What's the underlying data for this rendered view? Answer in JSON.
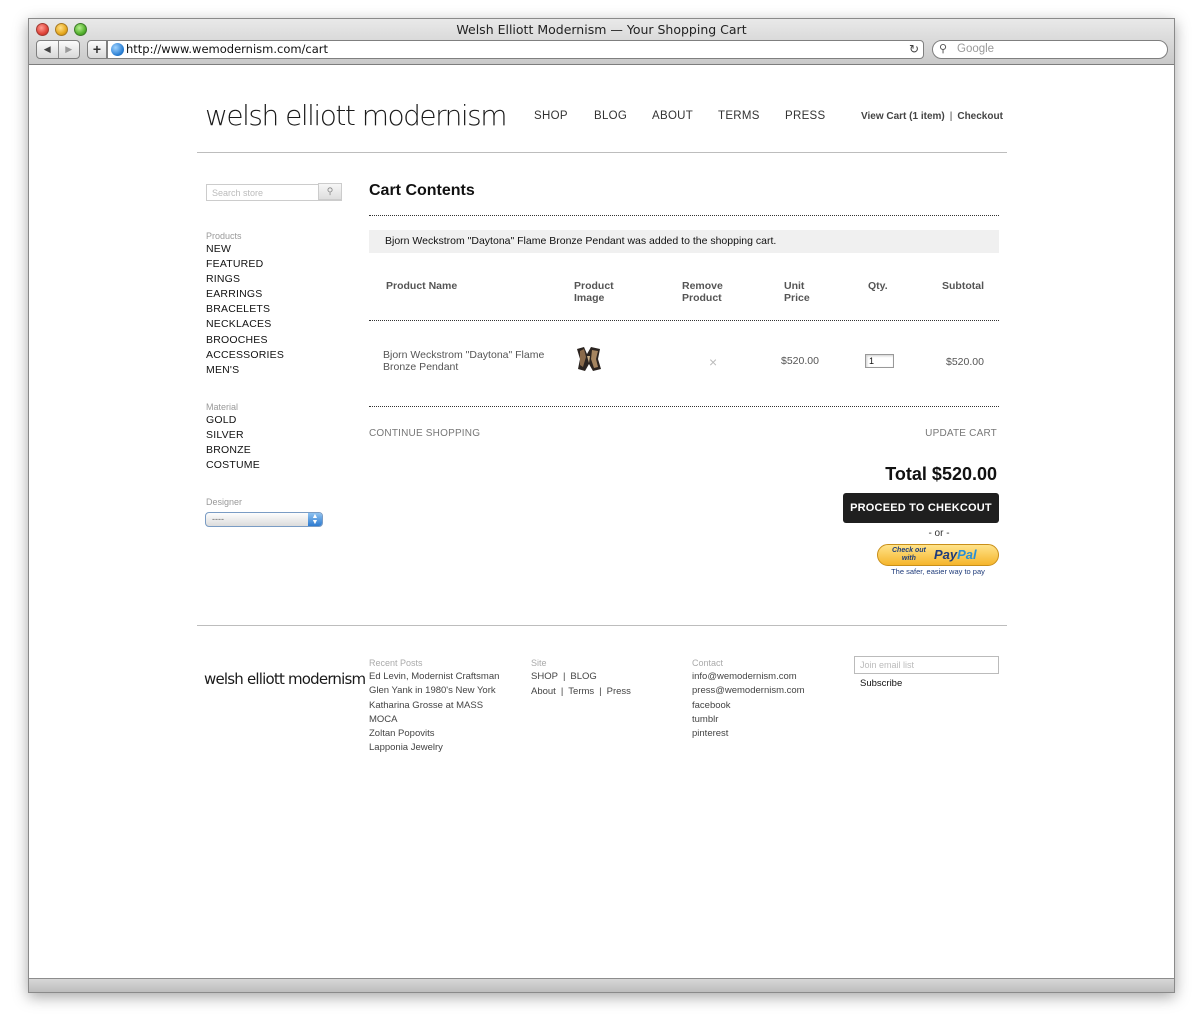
{
  "browser": {
    "window_title": "Welsh Elliott Modernism — Your Shopping Cart",
    "url": "http://www.wemodernism.com/cart",
    "search_placeholder": "Google"
  },
  "header": {
    "logo": "welsh elliott modernism",
    "nav": [
      "SHOP",
      "BLOG",
      "ABOUT",
      "TERMS",
      "PRESS"
    ],
    "view_cart": "View Cart (1 item)",
    "separator": "|",
    "checkout": "Checkout"
  },
  "sidebar": {
    "search_placeholder": "Search store",
    "products_heading": "Products",
    "products": [
      "NEW",
      "FEATURED",
      "RINGS",
      "EARRINGS",
      "BRACELETS",
      "NECKLACES",
      "BROOCHES",
      "ACCESSORIES",
      "MEN'S"
    ],
    "material_heading": "Material",
    "materials": [
      "GOLD",
      "SILVER",
      "BRONZE",
      "COSTUME"
    ],
    "designer_heading": "Designer",
    "designer_selected": "----"
  },
  "cart": {
    "title": "Cart Contents",
    "notice": "Bjorn Weckstrom \"Daytona\" Flame Bronze Pendant was added to the shopping cart.",
    "columns": {
      "product_name": "Product Name",
      "product_image": [
        "Product",
        "Image"
      ],
      "remove_product": [
        "Remove",
        "Product"
      ],
      "unit_price": [
        "Unit",
        "Price"
      ],
      "qty": "Qty.",
      "subtotal": "Subtotal"
    },
    "items": [
      {
        "name": "Bjorn Weckstrom \"Daytona\" Flame Bronze Pendant",
        "remove": "×",
        "unit_price": "$520.00",
        "qty": "1",
        "subtotal": "$520.00"
      }
    ],
    "continue_shopping": "CONTINUE SHOPPING",
    "update_cart": "UPDATE CART",
    "total": "Total $520.00",
    "proceed_button": "PROCEED TO CHEKCOUT",
    "or": "- or -",
    "paypal": {
      "check_out_line1": "Check out",
      "check_out_line2": "with",
      "pay": "Pay",
      "pal": "Pal",
      "tagline": "The safer, easier way to pay",
      "accent": "#1e3b7a"
    }
  },
  "footer": {
    "logo": "welsh elliott modernism",
    "recent_posts_heading": "Recent Posts",
    "recent_posts": [
      "Ed Levin, Modernist Craftsman",
      "Glen Yank in 1980's New York",
      "Katharina Grosse at MASS",
      "MOCA",
      "Zoltan Popovits",
      "Lapponia Jewelry"
    ],
    "site_heading": "Site",
    "site_row1": [
      "SHOP",
      "BLOG"
    ],
    "site_row2": [
      "About",
      "Terms",
      "Press"
    ],
    "contact_heading": "Contact",
    "contact": [
      "info@wemodernism.com",
      "press@wemodernism.com",
      "facebook",
      "tumblr",
      "pinterest"
    ],
    "email_placeholder": "Join email list",
    "subscribe": "Subscribe"
  }
}
